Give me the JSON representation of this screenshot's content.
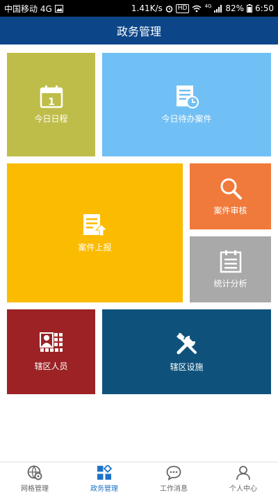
{
  "status_bar": {
    "carrier": "中国移动 4G",
    "speed": "1.41K/s",
    "hd": "HD",
    "net": "4G",
    "battery": "82%",
    "time": "6:50"
  },
  "header": {
    "title": "政务管理"
  },
  "tiles": [
    {
      "label": "今日日程",
      "icon": "calendar-icon",
      "color": "#bfbd49",
      "badge": "1"
    },
    {
      "label": "今日待办案件",
      "icon": "document-clock-icon",
      "color": "#71c0f5"
    },
    {
      "label": "案件上报",
      "icon": "document-upload-icon",
      "color": "#fbbb00"
    },
    {
      "label": "案件审核",
      "icon": "magnifier-icon",
      "color": "#f07a3b"
    },
    {
      "label": "统计分析",
      "icon": "clipboard-icon",
      "color": "#a9a9a9"
    },
    {
      "label": "辖区人员",
      "icon": "people-grid-icon",
      "color": "#9c2225"
    },
    {
      "label": "辖区设施",
      "icon": "tools-icon",
      "color": "#0e527c"
    }
  ],
  "bottom_nav": {
    "items": [
      {
        "label": "网格管理",
        "icon": "globe-gear-icon",
        "active": false
      },
      {
        "label": "政务管理",
        "icon": "grid-icon",
        "active": true
      },
      {
        "label": "工作消息",
        "icon": "chat-icon",
        "active": false
      },
      {
        "label": "个人中心",
        "icon": "user-icon",
        "active": false
      }
    ],
    "active_color": "#1e73c7",
    "inactive_color": "#666666"
  }
}
